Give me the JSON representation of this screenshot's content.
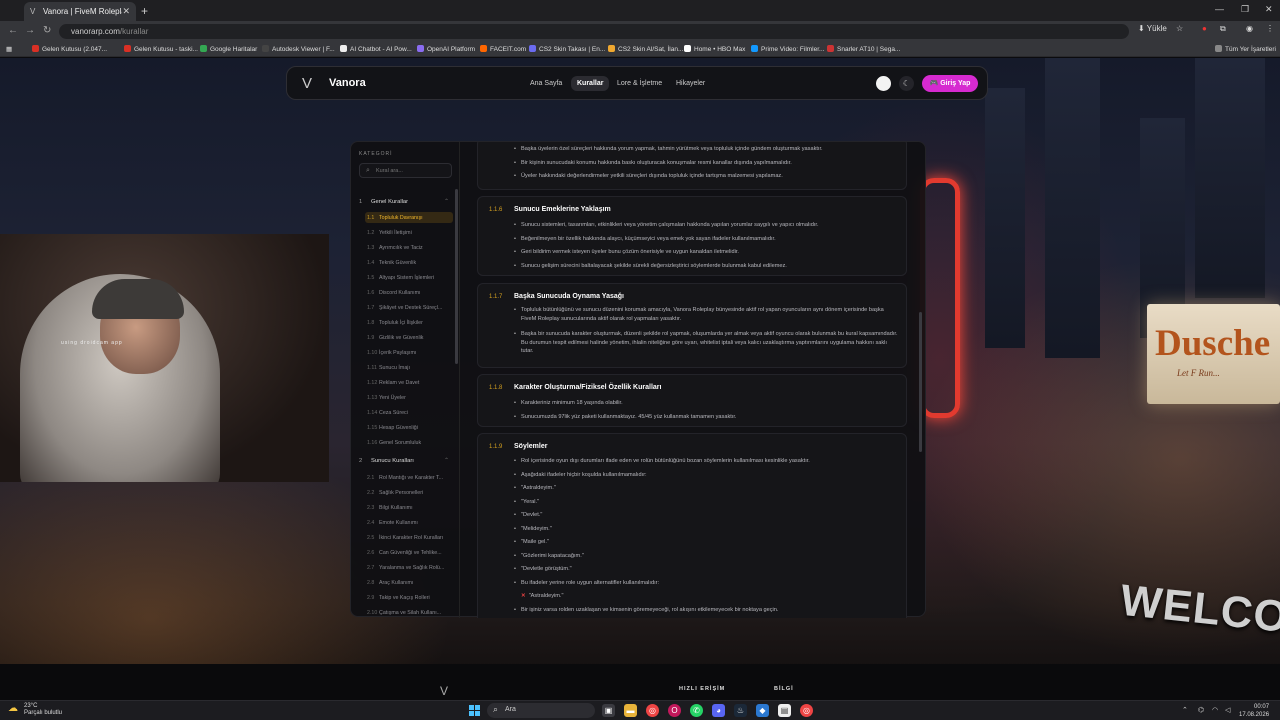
{
  "browser": {
    "tab_title": "Vanora | FiveM Roleplay",
    "url_host": "vanorarp.com",
    "url_path": "/kurallar",
    "update_label": "Yükle",
    "bookmarks": [
      "Gelen Kutusu (2.047...",
      "Gelen Kutusu - taski...",
      "Google Haritalar",
      "Autodesk Viewer | F...",
      "AI Chatbot - AI Pow...",
      "OpenAI Platform",
      "FACEIT.com",
      "CS2 Skin Takası | En...",
      "CS2 Skin Al/Sat, İlan...",
      "Home • HBO Max",
      "Prime Video: Filmler...",
      "Snarler AT10 | Sega..."
    ],
    "all_bookmarks": "Tüm Yer İşaretleri"
  },
  "site_nav": {
    "brand": "Vanora",
    "links": [
      "Ana Sayfa",
      "Kurallar",
      "Lore & İşletme",
      "Hikayeler"
    ],
    "login": "Giriş Yap"
  },
  "sidebar": {
    "heading": "KATEGORİ",
    "search_placeholder": "Kural ara...",
    "sections": [
      {
        "num": "1",
        "title": "Genel Kurallar"
      },
      {
        "num": "2",
        "title": "Sunucu Kuralları"
      }
    ],
    "items_s1": [
      {
        "num": "1.1",
        "label": "Topluluk Davranışı"
      },
      {
        "num": "1.2",
        "label": "Yetkili İletişimi"
      },
      {
        "num": "1.3",
        "label": "Ayrımcılık ve Taciz"
      },
      {
        "num": "1.4",
        "label": "Teknik Güvenlik"
      },
      {
        "num": "1.5",
        "label": "Altyapı Sistem İşlemleri"
      },
      {
        "num": "1.6",
        "label": "Discord Kullanımı"
      },
      {
        "num": "1.7",
        "label": "Şikâyet ve Destek Süreçl..."
      },
      {
        "num": "1.8",
        "label": "Topluluk İçi İlişkiler"
      },
      {
        "num": "1.9",
        "label": "Gizlilik ve Güvenlik"
      },
      {
        "num": "1.10",
        "label": "İçerik Paylaşımı"
      },
      {
        "num": "1.11",
        "label": "Sunucu İmajı"
      },
      {
        "num": "1.12",
        "label": "Reklam ve Davet"
      },
      {
        "num": "1.13",
        "label": "Yeni Üyeler"
      },
      {
        "num": "1.14",
        "label": "Ceza Süreci"
      },
      {
        "num": "1.15",
        "label": "Hesap Güvenliği"
      },
      {
        "num": "1.16",
        "label": "Genel Sorumluluk"
      }
    ],
    "items_s2": [
      {
        "num": "2.1",
        "label": "Rol Mantığı ve Karakter T..."
      },
      {
        "num": "2.2",
        "label": "Sağlık Personelleri"
      },
      {
        "num": "2.3",
        "label": "Bilgi Kullanımı"
      },
      {
        "num": "2.4",
        "label": "Emote Kullanımı"
      },
      {
        "num": "2.5",
        "label": "İkinci Karakter Rol Kuralları"
      },
      {
        "num": "2.6",
        "label": "Can Güvenliği ve Tehlike..."
      },
      {
        "num": "2.7",
        "label": "Yaralanma ve Sağlık Rolü..."
      },
      {
        "num": "2.8",
        "label": "Araç Kullanımı"
      },
      {
        "num": "2.9",
        "label": "Takip ve Kaçış Rolleri"
      },
      {
        "num": "2.10",
        "label": "Çatışma ve Silah Kullanı..."
      }
    ]
  },
  "rules": {
    "top_bullets": [
      "Başka üyelerin özel süreçleri hakkında yorum yapmak, tahmin yürütmek veya topluluk içinde gündem oluşturmak yasaktır.",
      "Bir kişinin sunucudaki konumu hakkında baskı oluşturacak konuşmalar resmi kanallar dışında yapılmamalıdır.",
      "Üyeler hakkındaki değerlendirmeler yetkili süreçleri dışında topluluk içinde tartışma malzemesi yapılamaz."
    ],
    "r116": {
      "num": "1.1.6",
      "title": "Sunucu Emeklerine Yaklaşım",
      "bullets": [
        "Sunucu sistemleri, tasarımları, etkinlikleri veya yönetim çalışmaları hakkında yapılan yorumlar saygılı ve yapıcı olmalıdır.",
        "Beğenilmeyen bir özellik hakkında alaycı, küçümseyici veya emek yok sayan ifadeler kullanılmamalıdır.",
        "Geri bildirim vermek isteyen üyeler bunu çözüm önerisiyle ve uygun kanaldan iletmelidir.",
        "Sunucu gelişim sürecini baltalayacak şekilde sürekli değersizleştirici söylemlerde bulunmak kabul edilemez."
      ]
    },
    "r117": {
      "num": "1.1.7",
      "title": "Başka Sunucuda Oynama Yasağı",
      "bullets": [
        "Topluluk bütünlüğünü ve sunucu düzenini korumak amacıyla, Vanora Roleplay bünyesinde aktif rol yapan oyuncuların aynı dönem içerisinde başka FiveM Roleplay sunucularında aktif olarak rol yapmaları yasaktır.",
        "Başka bir sunucuda karakter oluşturmak, düzenli şekilde rol yapmak, oluşumlarda yer almak veya aktif oyuncu olarak bulunmak bu kural kapsamındadır. Bu durumun tespit edilmesi halinde yönetim, ihlalin niteliğine göre uyarı, whitelist iptali veya kalıcı uzaklaştırma yaptırımlarını uygulama hakkını saklı tutar."
      ]
    },
    "r118": {
      "num": "1.1.8",
      "title": "Karakter Oluşturma/Fiziksel Özellik Kuralları",
      "bullets": [
        "Karakteriniz minimum 18 yaşında olabilir.",
        "Sunucumuzda 97lik yüz paketi kullanmaktayız. 45/45 yüz kullanmak tamamen yasaktır."
      ]
    },
    "r119": {
      "num": "1.1.9",
      "title": "Söylemler",
      "bullets": [
        "Rol içerisinde oyun dışı durumları ifade eden ve rolün bütünlüğünü bozan söylemlerin kullanılması kesinlikle yasaktır.",
        "Aşağıdaki ifadeler hiçbir koşulda kullanılmamalıdır:",
        "\"Astraldeyim.\"",
        "\"Yeral.\"",
        "\"Devlet.\"",
        "\"Melideyim.\"",
        "\"Maile gel.\"",
        "\"Gözlerimi kapatacağım.\"",
        "\"Devletle görüştüm.\"",
        "Bu ifadeler yerine role uygun alternatifler kullanılmalıdır:",
        "\"Astraldeyim.\"",
        "Bir işiniz varsa rolden uzaklaşan ve kimsenin göremeyeceği, rol akışını etkilemeyecek bir noktaya geçin."
      ]
    }
  },
  "webcam": {
    "watermark": "using droidcam app"
  },
  "billboard": {
    "title": "Dusche",
    "subtitle": "Let F Run..."
  },
  "street_sign": "WELCOME",
  "footer": {
    "col1": "HIZLI ERİŞİM",
    "col2": "BİLGİ"
  },
  "taskbar": {
    "temp": "23°C",
    "weather": "Parçalı bulutlu",
    "search": "Ara",
    "time": "00:07",
    "date": "17.08.2026"
  }
}
